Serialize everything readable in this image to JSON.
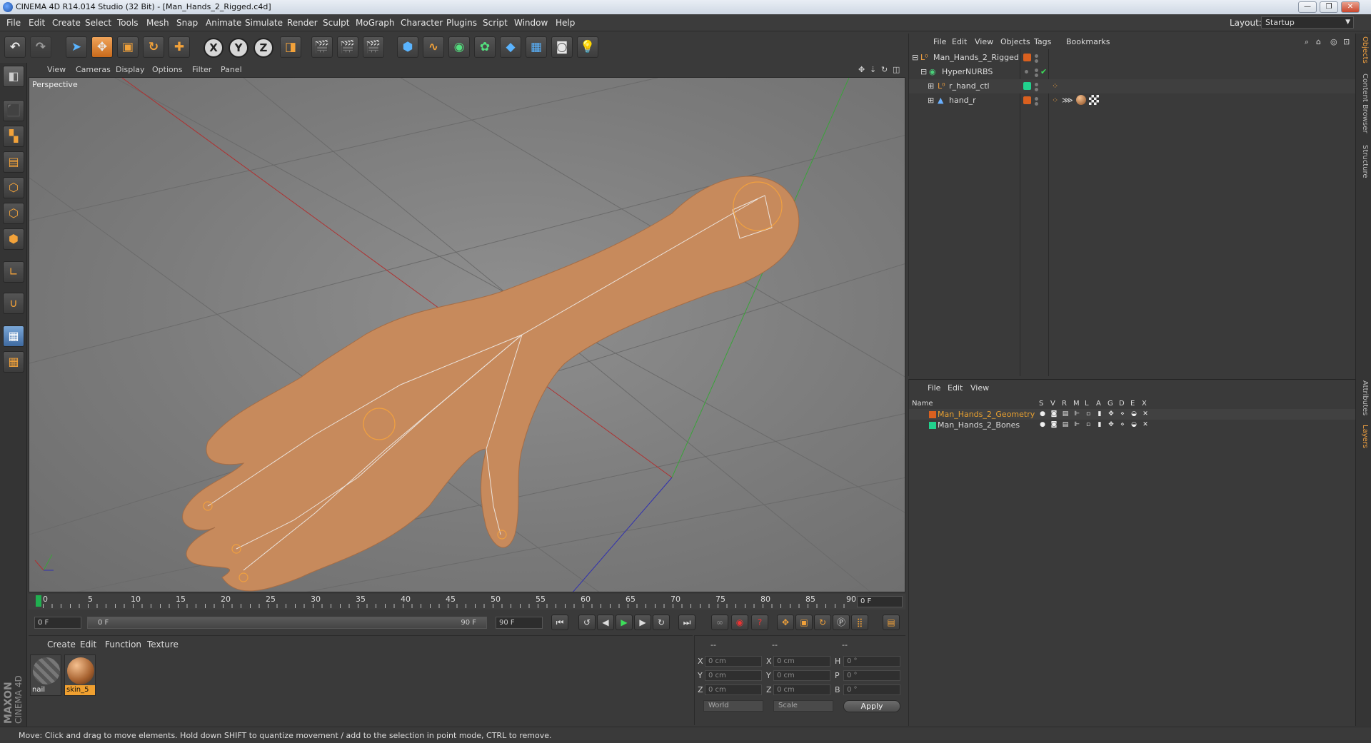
{
  "window": {
    "title": "CINEMA 4D R14.014 Studio (32 Bit) - [Man_Hands_2_Rigged.c4d]",
    "minimize": "—",
    "maximize": "❐",
    "close": "✕"
  },
  "menubar": {
    "items": [
      "File",
      "Edit",
      "Create",
      "Select",
      "Tools",
      "Mesh",
      "Snap",
      "Animate",
      "Simulate",
      "Render",
      "Sculpt",
      "MoGraph",
      "Character",
      "Plugins",
      "Script",
      "Window",
      "Help"
    ],
    "layout_label": "Layout:",
    "layout_value": "Startup"
  },
  "viewport": {
    "menu": [
      "View",
      "Cameras",
      "Display",
      "Options",
      "Filter",
      "Panel"
    ],
    "label": "Perspective"
  },
  "timeline": {
    "ticks": [
      "0",
      "5",
      "10",
      "15",
      "20",
      "25",
      "30",
      "35",
      "40",
      "45",
      "50",
      "55",
      "60",
      "65",
      "70",
      "75",
      "80",
      "85",
      "90"
    ],
    "current_frame": "0 F"
  },
  "playback": {
    "start": "0 F",
    "range_start": "0 F",
    "range_end": "90 F",
    "end": "90 F"
  },
  "materials": {
    "menu": [
      "Create",
      "Edit",
      "Function",
      "Texture"
    ],
    "items": [
      {
        "name": "nail"
      },
      {
        "name": "skin_5"
      }
    ]
  },
  "coords": {
    "header_left": "--",
    "header_mid": "--",
    "header_right": "--",
    "rows": [
      {
        "a": "X",
        "av": "0 cm",
        "b": "X",
        "bv": "0 cm",
        "c": "H",
        "cv": "0 °"
      },
      {
        "a": "Y",
        "av": "0 cm",
        "b": "Y",
        "bv": "0 cm",
        "c": "P",
        "cv": "0 °"
      },
      {
        "a": "Z",
        "av": "0 cm",
        "b": "Z",
        "bv": "0 cm",
        "c": "B",
        "cv": "0 °"
      }
    ],
    "world": "World",
    "scale": "Scale",
    "apply": "Apply"
  },
  "objects": {
    "menu": [
      "File",
      "Edit",
      "View",
      "Objects",
      "Tags",
      "Bookmarks"
    ],
    "rows": [
      {
        "name": "Man_Hands_2_Rigged",
        "chip": "#d9601f"
      },
      {
        "name": "HyperNURBS",
        "chip": ""
      },
      {
        "name": "r_hand_ctl",
        "chip": "#21d18d"
      },
      {
        "name": "hand_r",
        "chip": "#d9601f"
      }
    ],
    "checkmark": "✔"
  },
  "layers": {
    "menu": [
      "File",
      "Edit",
      "View"
    ],
    "headers": [
      "Name",
      "S",
      "V",
      "R",
      "M",
      "L",
      "A",
      "G",
      "D",
      "E",
      "X"
    ],
    "rows": [
      {
        "name": "Man_Hands_2_Geometry",
        "color": "#e8a030",
        "chip": "#d9601f"
      },
      {
        "name": "Man_Hands_2_Bones",
        "color": "#dcdcdc",
        "chip": "#21d18d"
      }
    ]
  },
  "sidetabs": [
    "Objects",
    "Content Browser",
    "Structure",
    "Attributes",
    "Layers"
  ],
  "logo": {
    "line1": "MAXON",
    "line2": "CINEMA 4D"
  },
  "status": "Move: Click and drag to move elements. Hold down SHIFT to quantize movement / add to the selection in point mode, CTRL to remove."
}
